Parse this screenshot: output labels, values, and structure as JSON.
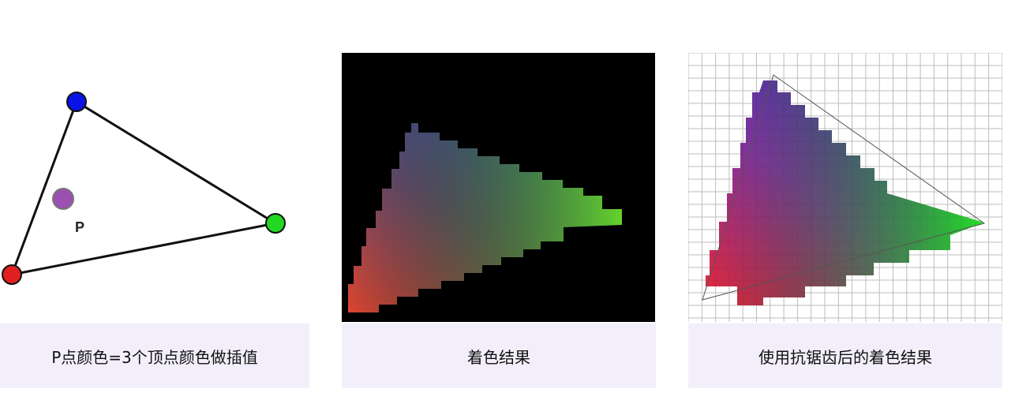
{
  "panels": [
    {
      "id": "interpolation",
      "caption": "P点颜色=3个顶点颜色做插值",
      "point_label": "P"
    },
    {
      "id": "shading-result",
      "caption": "着色结果"
    },
    {
      "id": "antialiased-result",
      "caption": "使用抗锯齿后的着色结果"
    }
  ],
  "vertex_colors": {
    "top": "#0a14e6",
    "right": "#22d822",
    "bottom": "#e02020",
    "point": "#9b4fb0"
  }
}
